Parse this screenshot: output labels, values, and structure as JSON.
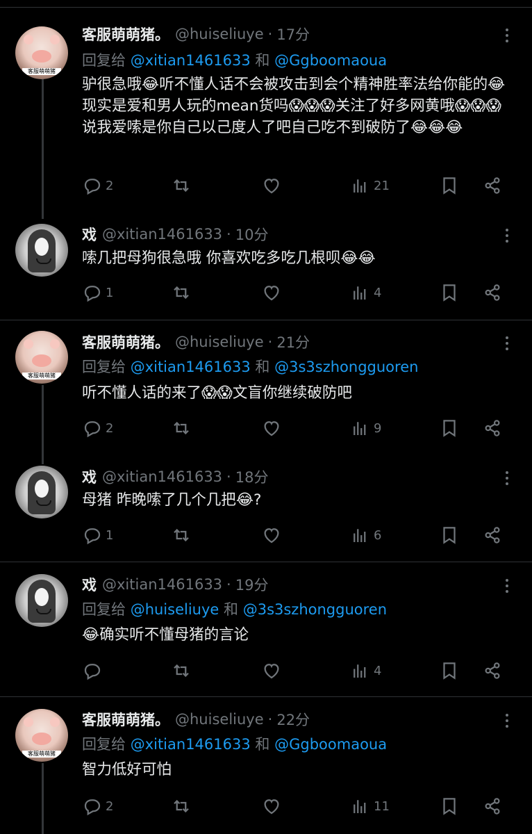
{
  "posts": [
    {
      "name": "客服萌萌猪。",
      "handle": "@huiseliuye",
      "time": "17分",
      "reply_prefix": "回复给",
      "reply_a": "@xitian1461633",
      "reply_and": "和",
      "reply_b": "@Ggboomaoua",
      "text": "驴很急哦😂听不懂人话不会被攻击到会个精神胜率法给你能的😂现实是爱和男人玩的mean货吗😱😱😱关注了好多网黄哦😱😱😱说我爱嗦是你自己以己度人了吧自己吃不到破防了😂😂😂",
      "replies": "2",
      "retweets": "",
      "likes": "",
      "views": "21",
      "avatar_label": "客服萌萌猪"
    },
    {
      "name": "戏",
      "handle": "@xitian1461633",
      "time": "10分",
      "text": "嗦几把母狗很急哦  你喜欢吃多吃几根呗😂😂",
      "replies": "1",
      "retweets": "",
      "likes": "",
      "views": "4"
    },
    {
      "name": "客服萌萌猪。",
      "handle": "@huiseliuye",
      "time": "21分",
      "reply_prefix": "回复给",
      "reply_a": "@xitian1461633",
      "reply_and": "和",
      "reply_b": "@3s3szhongguoren",
      "text": "听不懂人话的来了😱😱文盲你继续破防吧",
      "replies": "2",
      "retweets": "",
      "likes": "",
      "views": "9",
      "avatar_label": "客服萌萌猪"
    },
    {
      "name": "戏",
      "handle": "@xitian1461633",
      "time": "18分",
      "text": "母猪 昨晚嗦了几个几把😂?",
      "replies": "1",
      "retweets": "",
      "likes": "",
      "views": "6"
    },
    {
      "name": "戏",
      "handle": "@xitian1461633",
      "time": "19分",
      "reply_prefix": "回复给",
      "reply_a": "@huiseliuye",
      "reply_and": "和",
      "reply_b": "@3s3szhongguoren",
      "text": "😂确实听不懂母猪的言论",
      "replies": "",
      "retweets": "",
      "likes": "",
      "views": "4"
    },
    {
      "name": "客服萌萌猪。",
      "handle": "@huiseliuye",
      "time": "22分",
      "reply_prefix": "回复给",
      "reply_a": "@xitian1461633",
      "reply_and": "和",
      "reply_b": "@Ggboomaoua",
      "text": "智力低好可怕",
      "replies": "2",
      "retweets": "",
      "likes": "",
      "views": "11",
      "avatar_label": "客服萌萌猪"
    }
  ],
  "colors": {
    "link": "#1d9bf0",
    "muted": "#71767b",
    "text": "#e7e9ea",
    "border": "#2f3336"
  }
}
